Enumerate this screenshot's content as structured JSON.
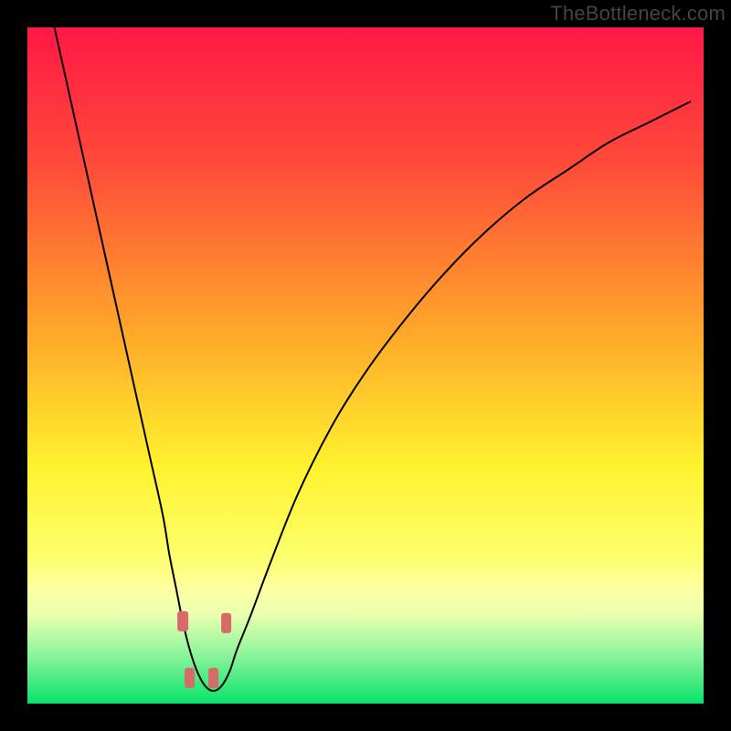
{
  "watermark": "TheBottleneck.com",
  "colors": {
    "bg": "#000000",
    "gradient_stops": [
      {
        "pct": 0,
        "color": "#ff1846"
      },
      {
        "pct": 20,
        "color": "#ff4a3a"
      },
      {
        "pct": 45,
        "color": "#ffa72a"
      },
      {
        "pct": 65,
        "color": "#fff22e"
      },
      {
        "pct": 78,
        "color": "#fdff6a"
      },
      {
        "pct": 83,
        "color": "#feffa0"
      },
      {
        "pct": 87,
        "color": "#e8ffb0"
      },
      {
        "pct": 93,
        "color": "#88f49a"
      },
      {
        "pct": 100,
        "color": "#08e26a"
      }
    ],
    "curve": "#000000",
    "marker": "#d86a6a"
  },
  "chart_data": {
    "type": "line",
    "title": "",
    "xlabel": "",
    "ylabel": "",
    "xlim": [
      0,
      100
    ],
    "ylim": [
      0,
      100
    ],
    "comment": "x = relative horizontal position (percent of plot width), y = relative height (100 = top). Values are estimates read off pixels; image has no numeric axes.",
    "series": [
      {
        "name": "curve",
        "x": [
          4,
          6,
          8,
          10,
          12,
          14,
          16,
          18,
          20,
          21,
          22,
          23,
          24,
          25,
          26,
          27,
          28,
          29,
          30,
          31,
          33,
          36,
          40,
          45,
          50,
          56,
          62,
          68,
          74,
          80,
          86,
          92,
          98
        ],
        "y": [
          100,
          91,
          82,
          73,
          64,
          55,
          46,
          37,
          28,
          22,
          17,
          12,
          8,
          5,
          3,
          2,
          2,
          3,
          5,
          8,
          13,
          21,
          31,
          41,
          49,
          57,
          64,
          70,
          75,
          79,
          83,
          86,
          89
        ]
      }
    ],
    "markers": [
      {
        "x": 23.0,
        "y": 12.2,
        "w": 1.6,
        "h": 3.0
      },
      {
        "x": 24.0,
        "y": 3.8,
        "w": 1.6,
        "h": 3.0
      },
      {
        "x": 27.5,
        "y": 3.8,
        "w": 1.6,
        "h": 3.0
      },
      {
        "x": 29.4,
        "y": 11.9,
        "w": 1.6,
        "h": 3.0
      }
    ]
  }
}
